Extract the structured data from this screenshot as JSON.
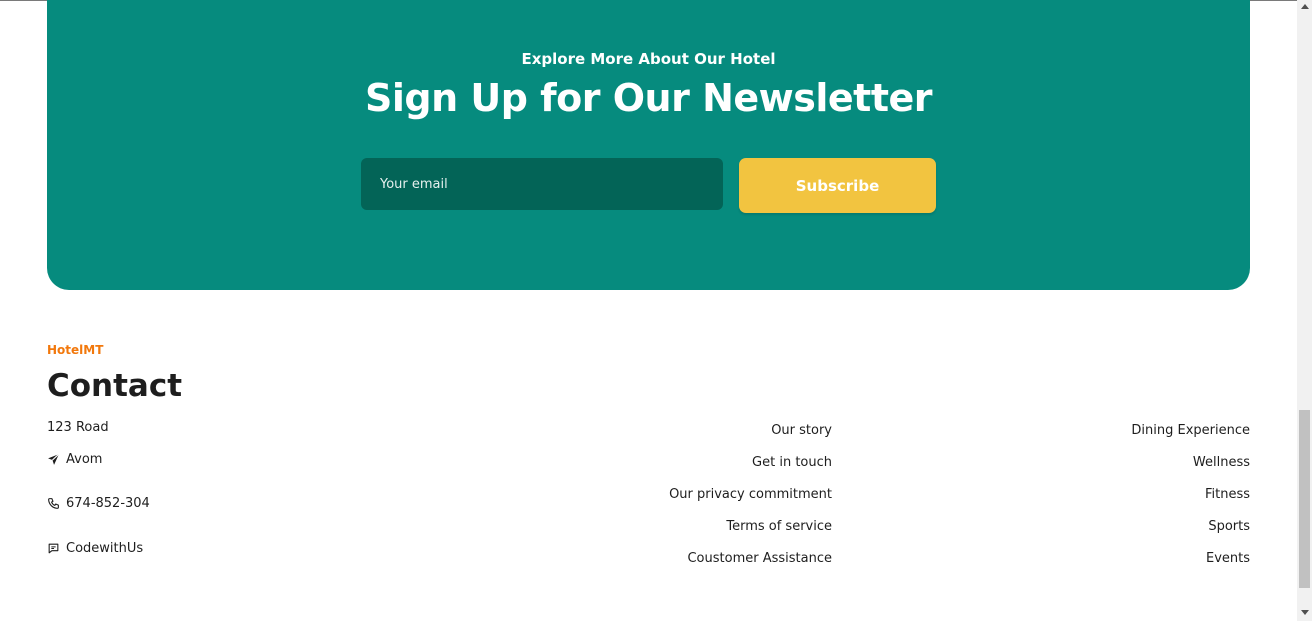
{
  "newsletter": {
    "subtitle": "Explore More About Our Hotel",
    "title": "Sign Up for Our Newsletter",
    "email_placeholder": "Your email",
    "subscribe_label": "Subscribe",
    "bg_color": "#068b7e",
    "input_color": "#036457",
    "button_color": "#f2c440"
  },
  "footer": {
    "brand": "HotelMT",
    "brand_color": "#f2780c",
    "contact_title": "Contact",
    "address": "123 Road",
    "city": "Avom",
    "phone": "674-852-304",
    "message": "CodewithUs",
    "icons": [
      "send-icon",
      "phone-icon",
      "message-icon"
    ],
    "links_col1": [
      "Our story",
      "Get in touch",
      "Our privacy commitment",
      "Terms of service",
      "Coustomer Assistance"
    ],
    "links_col2": [
      "Dining Experience",
      "Wellness",
      "Fitness",
      "Sports",
      "Events"
    ]
  }
}
